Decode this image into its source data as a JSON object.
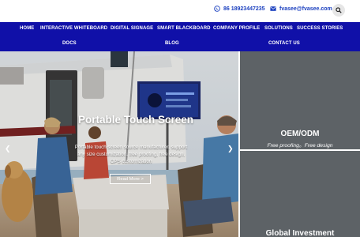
{
  "contact": {
    "phone": "86 18923447235",
    "email": "fvasee@fvasee.com",
    "icons": [
      "whatsapp-icon",
      "mail-icon",
      "search-icon"
    ],
    "accent_color": "#1a3fbf"
  },
  "nav": {
    "background": "#1010a8",
    "items": [
      "HOME",
      "INTERACTIVE WHITEBOARD",
      "DIGITAL SIGNAGE",
      "SMART BLACKBOARD",
      "COMPANY PROFILE",
      "SOLUTIONS",
      "SUCCESS STORIES",
      "DOCS",
      "BLOG",
      "CONTACT US"
    ]
  },
  "hero": {
    "title": "Portable Touch Screen",
    "description": "Portable touch screen source manufacturer, support any size customization, free proofing, free design, OPS customization",
    "button_label": "Read More >",
    "prev_icon": "chevron-left-icon",
    "next_icon": "chevron-right-icon"
  },
  "panels": [
    {
      "title": "OEM/ODM",
      "subtitle": "Free proofing。Free design"
    },
    {
      "title": "Global Investment",
      "subtitle": ""
    }
  ]
}
